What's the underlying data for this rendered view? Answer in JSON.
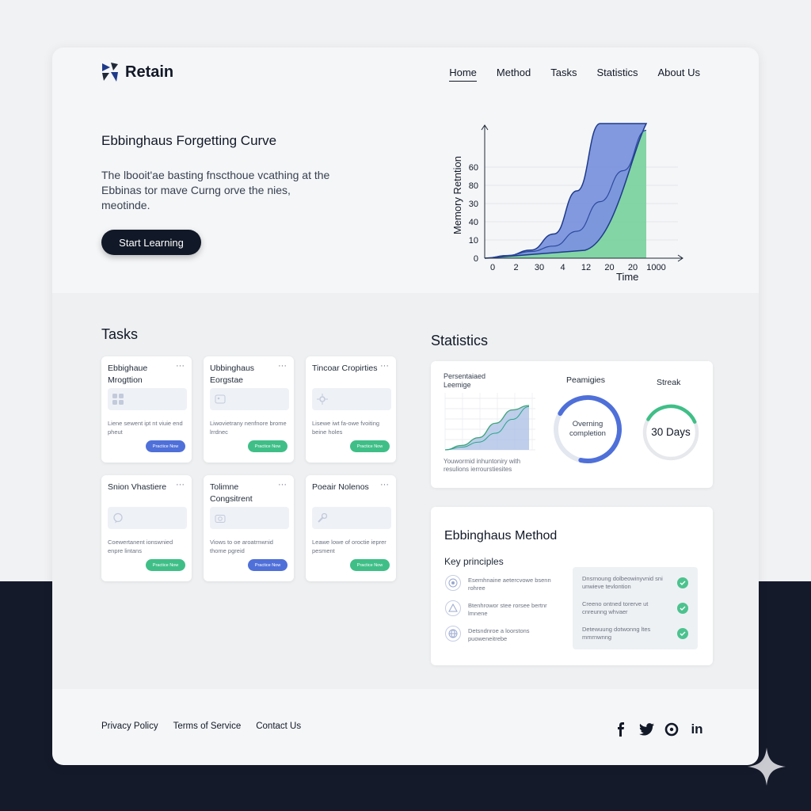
{
  "brand": {
    "name": "Retain"
  },
  "nav": {
    "items": [
      "Home",
      "Method",
      "Tasks",
      "Statistics",
      "About Us"
    ],
    "active": "Home"
  },
  "hero": {
    "title": "Ebbinghaus Forgetting Curve",
    "description": "The lbooit'ae basting fnscthoue vcathing at the Ebbinas tor mave Curng orve the nies, meotinde.",
    "cta_label": "Start Learning"
  },
  "tasks": {
    "title": "Tasks",
    "items": [
      {
        "name": "Ebbighaue Mrogttion",
        "desc": "Liene sewent ipt nt viuie end pheut",
        "button": "Practice Now",
        "button_color": "#4f70d9",
        "icon": "grid-icon"
      },
      {
        "name": "Ubbinghaus Eorgstae",
        "desc": "Liwovietrany nenfnore brome lrrdnec",
        "button": "Practice Now",
        "button_color": "#3fbf87",
        "icon": "image-icon"
      },
      {
        "name": "Tincoar Cropirties",
        "desc": "Lisewe iwt fa-owe fvoiting beine holes",
        "button": "Practice Now",
        "button_color": "#3fbf87",
        "icon": "settings-icon"
      },
      {
        "name": "Snion Vhastiere",
        "desc": "Coewertanent ionswnied enpre lintans",
        "button": "Practice Now",
        "button_color": "#3fbf87",
        "icon": "chat-icon"
      },
      {
        "name": "Tolimne Congsitrent",
        "desc": "Viows to oe aroatrnwnid thome pgreid",
        "button": "Practice Now",
        "button_color": "#4f70d9",
        "icon": "camera-icon"
      },
      {
        "name": "Poeair Nolenos",
        "desc": "Leawe lowe of oroctie ieprer pesment",
        "button": "Practice Now",
        "button_color": "#3fbf87",
        "icon": "wrench-icon"
      }
    ]
  },
  "statistics": {
    "title": "Statistics",
    "card_title": "Persentaiaed Leemige",
    "caption": "Youwormid inhuntoniry with resulions ierrourstiesites",
    "progress": {
      "label": "Peamigies",
      "center_text": "Overning completion",
      "value": 0.7,
      "color": "#4f70d9"
    },
    "streak": {
      "label": "Streak",
      "value_text": "30 Days",
      "value": 0.35,
      "color": "#3fbf87"
    }
  },
  "method": {
    "title": "Ebbinghaus Method",
    "subtitle": "Key principles",
    "principles": [
      {
        "text": "Esemhnaine aetercvowe bsenn rohree",
        "icon": "target-icon"
      },
      {
        "text": "Btenhrowor stee rorsee bertnr lmnene",
        "icon": "triangle-icon"
      },
      {
        "text": "Detsndnroe a loorstons puoweneitrebe",
        "icon": "globe-icon"
      }
    ],
    "checklist": [
      {
        "text": "Dnsrnoung dolbeowinyvnid sni unwieve tevlontion",
        "icon": "check-circle-icon"
      },
      {
        "text": "Creeno ontned torerve ut cnreunng whvaer",
        "icon": "check-circle-icon"
      },
      {
        "text": "Detewuung dotwonng ltes mmrnwnng",
        "icon": "check-circle-icon"
      }
    ]
  },
  "hero_chart": {
    "ylabel": "Memory Retntion",
    "xlabel": "Time",
    "yticks": [
      "0",
      "10",
      "40",
      "30",
      "80",
      "60"
    ],
    "xticks": [
      "0",
      "2",
      "30",
      "4",
      "12",
      "20",
      "20",
      "1000"
    ]
  },
  "footer": {
    "links": [
      "Privacy Policy",
      "Terms of Service",
      "Contact Us"
    ],
    "social": [
      "facebook-icon",
      "twitter-icon",
      "instagram-icon",
      "linkedin-icon"
    ]
  },
  "colors": {
    "dark": "#151a2b",
    "blue": "#4f70d9",
    "green": "#3fbf87"
  },
  "chart_data": [
    {
      "type": "area",
      "title": "",
      "xlabel": "Time",
      "ylabel": "Memory Retntion",
      "x": [
        "0",
        "2",
        "30",
        "4",
        "12",
        "20",
        "20",
        "1000"
      ],
      "series": [
        {
          "values": [
            0,
            2,
            6,
            18,
            50,
            100,
            100,
            100
          ]
        },
        {
          "values": [
            0,
            2,
            5,
            9,
            20,
            42,
            65,
            95
          ]
        }
      ],
      "ylim": [
        0,
        60
      ]
    },
    {
      "type": "area",
      "title": "Persentaiaed Leemige",
      "series": [
        {
          "values": [
            0,
            8,
            22,
            48,
            72,
            80
          ]
        },
        {
          "values": [
            0,
            5,
            14,
            30,
            55,
            78
          ]
        }
      ]
    }
  ]
}
